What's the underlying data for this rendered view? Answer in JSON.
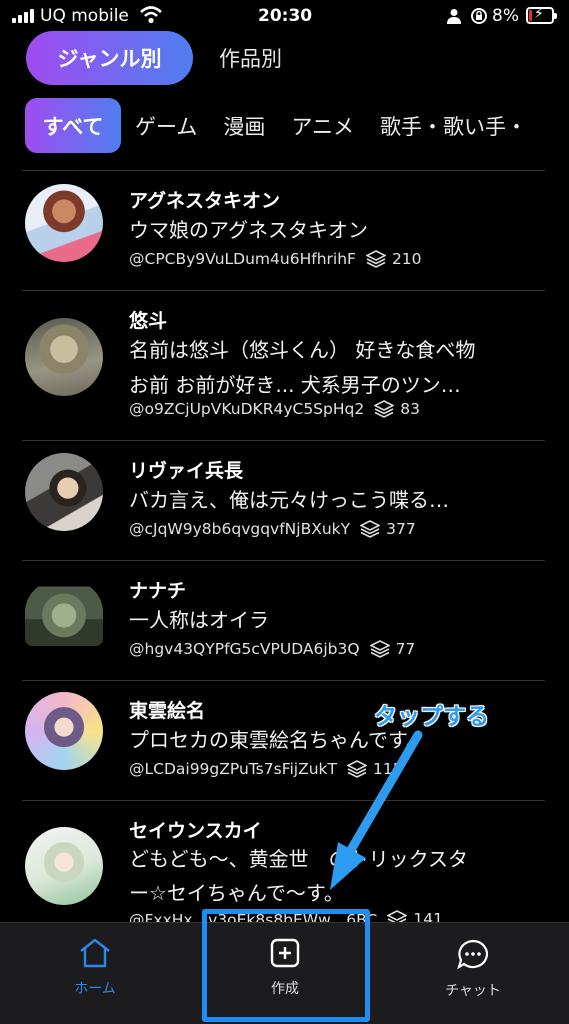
{
  "status_bar": {
    "carrier": "UQ mobile",
    "time": "20:30",
    "battery": "8%",
    "battery_level": 0.08,
    "colors": {
      "battery_low": "#e5312b"
    }
  },
  "tabs": {
    "primary": [
      "ジャンル別",
      "作品別"
    ],
    "selected_primary": "ジャンル別"
  },
  "genres": {
    "all": "すべて",
    "items": [
      "ゲーム",
      "漫画",
      "アニメ",
      "歌手・歌い手・"
    ]
  },
  "characters": [
    {
      "name": "アグネスタキオン",
      "description": [
        "ウマ娘のアグネスタキオン"
      ],
      "handle": "@CPCBy9VuLDum4u6HfhrihF",
      "count": "210"
    },
    {
      "name": "悠斗",
      "description": [
        "名前は悠斗（悠斗くん） 好きな食べ物",
        "お前 お前が好き... 犬系男子のツン…"
      ],
      "handle": "@o9ZCjUpVKuDKR4yC5SpHq2",
      "count": "83"
    },
    {
      "name": "リヴァイ兵長",
      "description": [
        "バカ言え、俺は元々けっこう喋る…"
      ],
      "handle": "@cJqW9y8b6qvgqvfNjBXukY",
      "count": "377"
    },
    {
      "name": "ナナチ",
      "description": [
        "一人称はオイラ"
      ],
      "handle": "@hgv43QYPfG5cVPUDA6jb3Q",
      "count": "77"
    },
    {
      "name": "東雲絵名",
      "description": [
        "プロセカの東雲絵名ちゃんです。"
      ],
      "handle": "@LCDai99gZPuTs7sFijZukT",
      "count": "115"
    },
    {
      "name": "セイウンスカイ",
      "description": [
        "どもども〜、黄金世　のトリックスタ",
        "ー☆セイちゃんで〜す。"
      ],
      "handle": "@FxxHx　v3oEk8s8bEWw　6BC",
      "count": "141"
    }
  ],
  "annotation": {
    "label": "タップする",
    "color": "#2d9cf0"
  },
  "bottom_nav": {
    "home": "ホーム",
    "create": "作成",
    "chat": "チャット",
    "active": "ホーム",
    "colors": {
      "active": "#2d86e8",
      "highlight": "#1e8df0"
    }
  },
  "icons": [
    "signal-icon",
    "wifi-icon",
    "person-icon",
    "rotation-lock-icon",
    "battery-icon",
    "layers-icon",
    "home-icon",
    "plus-square-icon",
    "chat-bubble-icon",
    "arrow-annotation"
  ]
}
